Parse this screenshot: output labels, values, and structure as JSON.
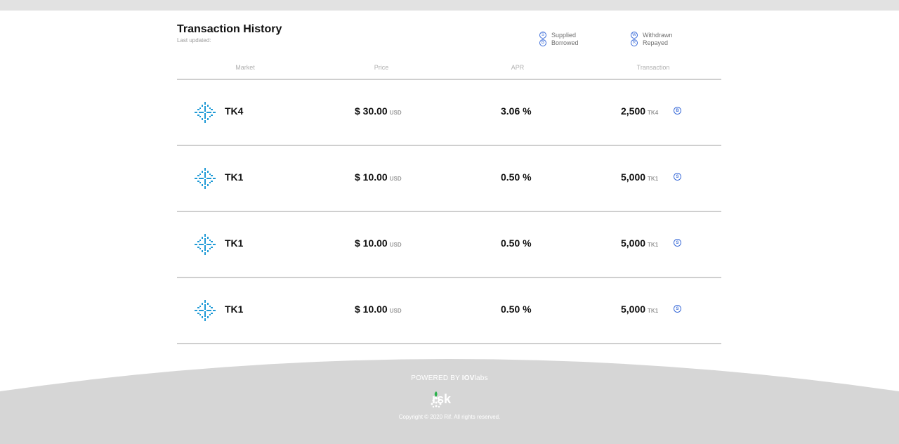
{
  "header": {
    "title": "Transaction History",
    "subtitle": "Last updated:"
  },
  "legend": [
    {
      "letter": "S",
      "label": "Supplied"
    },
    {
      "letter": "B",
      "label": "Borrowed"
    },
    {
      "letter": "W",
      "label": "Withdrawn"
    },
    {
      "letter": "R",
      "label": "Repayed"
    }
  ],
  "columns": [
    "Market",
    "Price",
    "APR",
    "Transaction"
  ],
  "rows": [
    {
      "market": "TK4",
      "price": "$ 30.00",
      "price_unit": "USD",
      "apr": "3.06 %",
      "amount": "2,500",
      "amount_unit": "TK4",
      "type": "B"
    },
    {
      "market": "TK1",
      "price": "$ 10.00",
      "price_unit": "USD",
      "apr": "0.50 %",
      "amount": "5,000",
      "amount_unit": "TK1",
      "type": "S"
    },
    {
      "market": "TK1",
      "price": "$ 10.00",
      "price_unit": "USD",
      "apr": "0.50 %",
      "amount": "5,000",
      "amount_unit": "TK1",
      "type": "S"
    },
    {
      "market": "TK1",
      "price": "$ 10.00",
      "price_unit": "USD",
      "apr": "0.50 %",
      "amount": "5,000",
      "amount_unit": "TK1",
      "type": "S"
    }
  ],
  "footer": {
    "powered_prefix": "POWERED BY ",
    "powered_brand": "IOV",
    "powered_suffix": "labs",
    "logo_text": "rsk",
    "copyright": "Copyright © 2020 Rif. All rights reserved."
  },
  "colors": {
    "accent": "#3a6bd8",
    "token_icon": "#1f9ad6",
    "footer_bg": "#d6d6d6"
  },
  "icons": {
    "token": "token-cross-arrows-icon",
    "rsk": "rsk-node-icon"
  }
}
